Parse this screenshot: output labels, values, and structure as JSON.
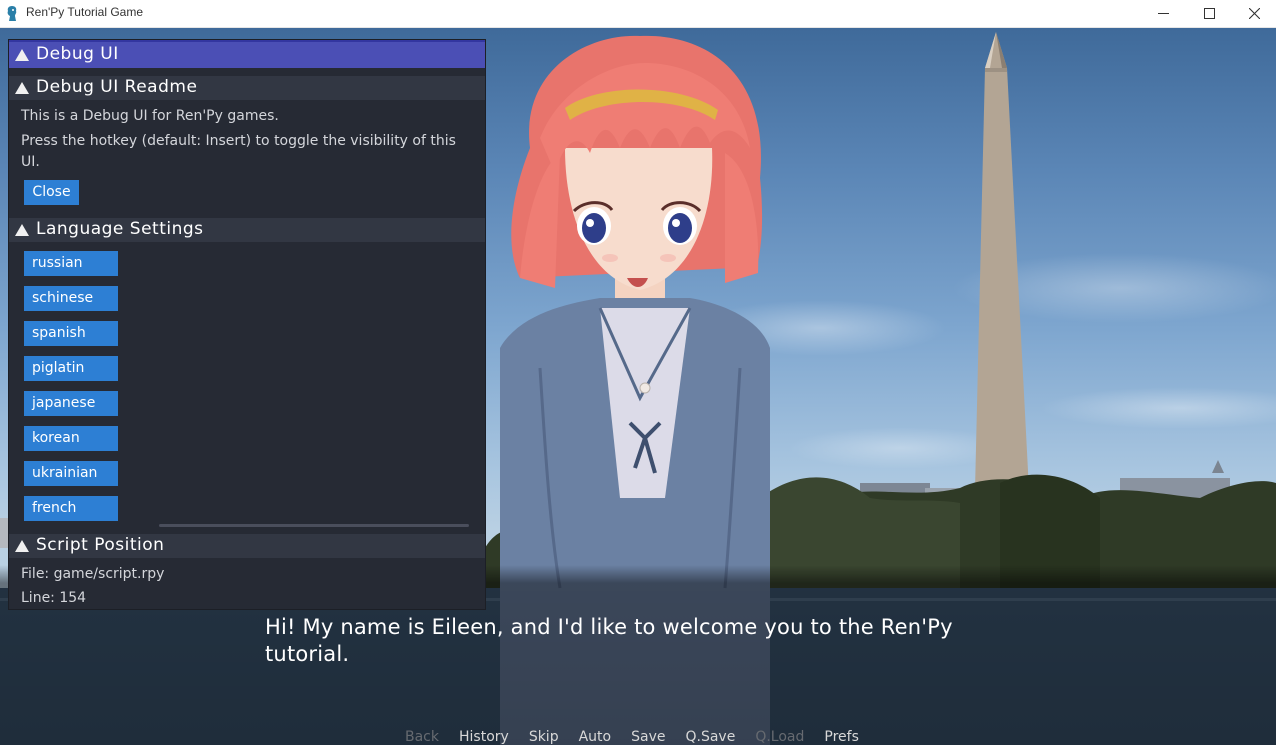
{
  "window": {
    "title": "Ren'Py Tutorial Game"
  },
  "debug_ui": {
    "header": "Debug UI",
    "readme": {
      "title": "Debug UI Readme",
      "line1": "This is a Debug UI for Ren'Py games.",
      "line2a": "Press the hotkey (default: Insert) to toggle the visibility of this",
      "line2b": "UI.",
      "close_label": "Close"
    },
    "language": {
      "title": "Language Settings",
      "options": [
        "russian",
        "schinese",
        "spanish",
        "piglatin",
        "japanese",
        "korean",
        "ukrainian",
        "french"
      ]
    },
    "script_position": {
      "title": "Script Position",
      "file": "File: game/script.rpy",
      "line": "Line: 154"
    }
  },
  "dialogue": {
    "text": "Hi! My name is Eileen, and I'd like to welcome you to the Ren'Py tutorial."
  },
  "quick_menu": {
    "items": [
      {
        "label": "Back",
        "enabled": false
      },
      {
        "label": "History",
        "enabled": true
      },
      {
        "label": "Skip",
        "enabled": true
      },
      {
        "label": "Auto",
        "enabled": true
      },
      {
        "label": "Save",
        "enabled": true
      },
      {
        "label": "Q.Save",
        "enabled": true
      },
      {
        "label": "Q.Load",
        "enabled": false
      },
      {
        "label": "Prefs",
        "enabled": true
      }
    ]
  },
  "colors": {
    "debug_header": "#4b4fb5",
    "debug_button": "#2d7fd4",
    "debug_bg": "#262a34"
  }
}
